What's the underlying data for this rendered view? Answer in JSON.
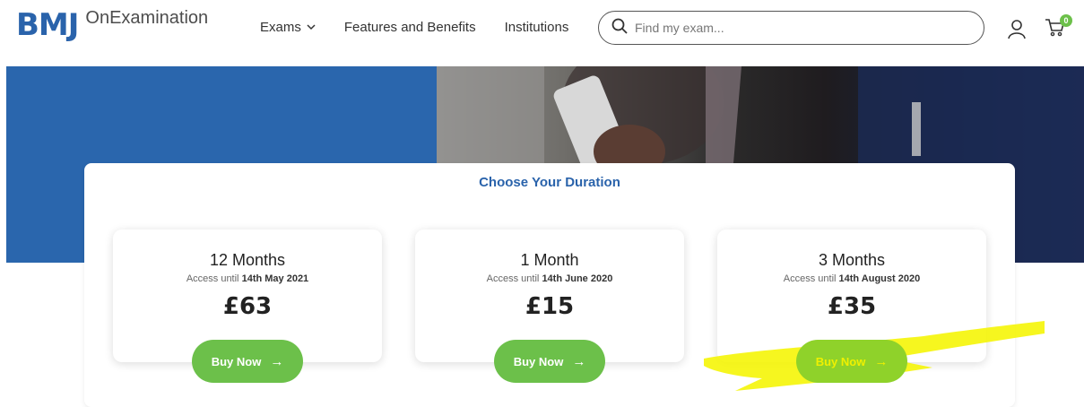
{
  "header": {
    "logo_main": "BMJ",
    "logo_sub": "OnExamination",
    "nav": [
      {
        "label": "Exams"
      },
      {
        "label": "Features and Benefits"
      },
      {
        "label": "Institutions"
      }
    ],
    "search_placeholder": "Find my exam...",
    "cart_count": "0"
  },
  "panel": {
    "title": "Choose Your Duration"
  },
  "plans": [
    {
      "title": "12 Months",
      "access_prefix": "Access until",
      "access_date": "14th May 2021",
      "price": "£63",
      "button": "Buy Now"
    },
    {
      "title": "1 Month",
      "access_prefix": "Access until",
      "access_date": "14th June 2020",
      "price": "£15",
      "button": "Buy Now"
    },
    {
      "title": "3 Months",
      "access_prefix": "Access until",
      "access_date": "14th August 2020",
      "price": "£35",
      "button": "Buy Now"
    }
  ],
  "colors": {
    "brand_blue": "#2a63ab",
    "accent_green": "#6cc04a",
    "highlight_yellow": "#f5f500"
  }
}
